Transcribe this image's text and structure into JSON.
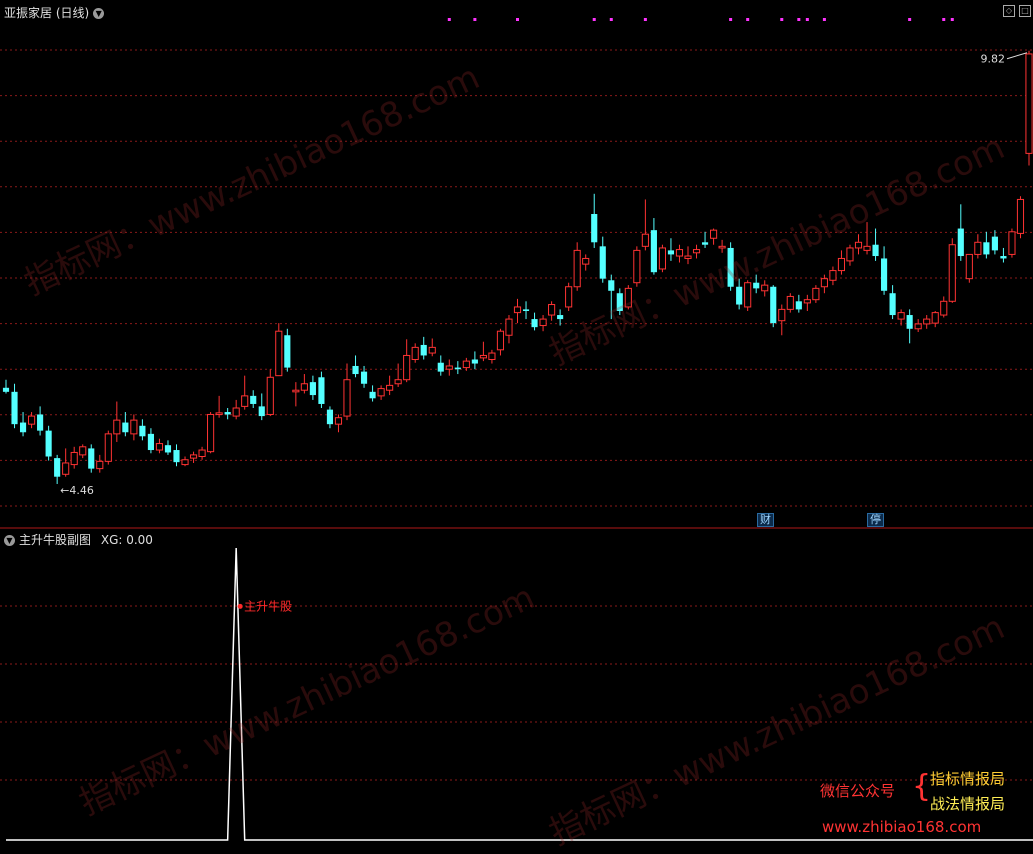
{
  "header": {
    "title": "亚振家居 (日线)",
    "sub_title": "主升牛股副图",
    "sub_indicator": "XG: 0.00"
  },
  "markers": {
    "finance": "财",
    "halt": "停"
  },
  "promo": {
    "wechat_label": "微信公众号",
    "brace": "{",
    "account_1": "指标情报局",
    "account_2": "战法情报局",
    "site": "www.zhibiao168.com"
  },
  "watermark_text": "指标网：www.zhibiao168.com",
  "colors": {
    "up": "#ff3333",
    "down": "#54ffff",
    "grid": "#8a1a1a",
    "signal_dot": "#ff33ff",
    "line": "#ffffff",
    "label": "#ff2a2a"
  },
  "chart_data": [
    {
      "type": "candlestick",
      "title": "亚振家居 (日线)",
      "ylim": [
        4.2,
        10.2
      ],
      "high_label": "9.82",
      "low_label": "4.46",
      "ohlc": [
        [
          5.65,
          5.75,
          5.6,
          5.58
        ],
        [
          5.6,
          5.7,
          5.2,
          5.15
        ],
        [
          5.22,
          5.35,
          5.1,
          5.05
        ],
        [
          5.2,
          5.35,
          5.3,
          5.15
        ],
        [
          5.32,
          5.42,
          5.12,
          5.06
        ],
        [
          5.12,
          5.18,
          4.8,
          4.75
        ],
        [
          4.78,
          4.82,
          4.55,
          4.46
        ],
        [
          4.58,
          4.9,
          4.72,
          4.55
        ],
        [
          4.7,
          4.92,
          4.85,
          4.65
        ],
        [
          4.82,
          4.95,
          4.92,
          4.78
        ],
        [
          4.9,
          4.95,
          4.65,
          4.6
        ],
        [
          4.65,
          4.82,
          4.74,
          4.6
        ],
        [
          4.74,
          5.12,
          5.08,
          4.7
        ],
        [
          5.08,
          5.48,
          5.25,
          4.98
        ],
        [
          5.22,
          5.35,
          5.1,
          5.05
        ],
        [
          5.08,
          5.32,
          5.25,
          5.0
        ],
        [
          5.18,
          5.26,
          5.05,
          5.0
        ],
        [
          5.08,
          5.15,
          4.88,
          4.84
        ],
        [
          4.88,
          5.02,
          4.96,
          4.84
        ],
        [
          4.94,
          5.0,
          4.85,
          4.82
        ],
        [
          4.88,
          4.95,
          4.73,
          4.68
        ],
        [
          4.7,
          4.8,
          4.76,
          4.68
        ],
        [
          4.78,
          4.86,
          4.82,
          4.72
        ],
        [
          4.8,
          4.92,
          4.88,
          4.76
        ],
        [
          4.86,
          5.35,
          5.32,
          4.84
        ],
        [
          5.32,
          5.55,
          5.34,
          5.28
        ],
        [
          5.35,
          5.4,
          5.32,
          5.26
        ],
        [
          5.3,
          5.5,
          5.4,
          5.26
        ],
        [
          5.42,
          5.8,
          5.55,
          5.38
        ],
        [
          5.55,
          5.62,
          5.45,
          5.4
        ],
        [
          5.42,
          5.58,
          5.3,
          5.25
        ],
        [
          5.32,
          5.88,
          5.78,
          5.3
        ],
        [
          5.8,
          6.45,
          6.35,
          5.9
        ],
        [
          6.3,
          6.38,
          5.9,
          5.85
        ],
        [
          5.6,
          5.72,
          5.62,
          5.42
        ],
        [
          5.62,
          5.82,
          5.7,
          5.58
        ],
        [
          5.72,
          5.8,
          5.56,
          5.5
        ],
        [
          5.78,
          5.85,
          5.45,
          5.4
        ],
        [
          5.38,
          5.42,
          5.2,
          5.15
        ],
        [
          5.2,
          5.32,
          5.28,
          5.1
        ],
        [
          5.3,
          5.95,
          5.75,
          5.25
        ],
        [
          5.92,
          6.05,
          5.82,
          5.78
        ],
        [
          5.85,
          5.92,
          5.7,
          5.65
        ],
        [
          5.6,
          5.68,
          5.52,
          5.48
        ],
        [
          5.55,
          5.68,
          5.64,
          5.5
        ],
        [
          5.62,
          5.8,
          5.68,
          5.56
        ],
        [
          5.7,
          5.95,
          5.75,
          5.66
        ],
        [
          5.75,
          6.25,
          6.05,
          5.72
        ],
        [
          6.0,
          6.2,
          6.15,
          5.96
        ],
        [
          6.18,
          6.28,
          6.05,
          6.0
        ],
        [
          6.08,
          6.26,
          6.15,
          6.04
        ],
        [
          5.96,
          6.05,
          5.85,
          5.8
        ],
        [
          5.88,
          6.0,
          5.92,
          5.8
        ],
        [
          5.9,
          5.98,
          5.88,
          5.82
        ],
        [
          5.9,
          6.02,
          5.98,
          5.86
        ],
        [
          6.0,
          6.1,
          5.95,
          5.88
        ],
        [
          6.02,
          6.22,
          6.05,
          5.98
        ],
        [
          6.0,
          6.12,
          6.08,
          5.95
        ],
        [
          6.12,
          6.38,
          6.35,
          6.05
        ],
        [
          6.3,
          6.55,
          6.5,
          6.2
        ],
        [
          6.58,
          6.75,
          6.65,
          6.45
        ],
        [
          6.62,
          6.72,
          6.6,
          6.5
        ],
        [
          6.5,
          6.58,
          6.4,
          6.36
        ],
        [
          6.42,
          6.55,
          6.5,
          6.35
        ],
        [
          6.55,
          6.72,
          6.68,
          6.48
        ],
        [
          6.55,
          6.62,
          6.5,
          6.42
        ],
        [
          6.65,
          6.95,
          6.9,
          6.6
        ],
        [
          6.9,
          7.45,
          7.35,
          6.85
        ],
        [
          7.18,
          7.3,
          7.25,
          7.1
        ],
        [
          7.8,
          8.05,
          7.45,
          7.38
        ],
        [
          7.4,
          7.52,
          7.0,
          6.95
        ],
        [
          6.98,
          7.05,
          6.85,
          6.5
        ],
        [
          6.82,
          6.88,
          6.6,
          6.55
        ],
        [
          6.65,
          6.92,
          6.88,
          6.62
        ],
        [
          6.95,
          7.4,
          7.35,
          6.9
        ],
        [
          7.4,
          7.98,
          7.55,
          7.35
        ],
        [
          7.6,
          7.75,
          7.08,
          7.05
        ],
        [
          7.12,
          7.42,
          7.38,
          7.08
        ],
        [
          7.35,
          7.5,
          7.3,
          7.22
        ],
        [
          7.28,
          7.42,
          7.36,
          7.2
        ],
        [
          7.25,
          7.4,
          7.28,
          7.18
        ],
        [
          7.32,
          7.42,
          7.36,
          7.25
        ],
        [
          7.45,
          7.58,
          7.42,
          7.38
        ],
        [
          7.5,
          7.62,
          7.6,
          7.42
        ],
        [
          7.38,
          7.48,
          7.4,
          7.32
        ],
        [
          7.38,
          7.45,
          6.9,
          6.85
        ],
        [
          6.9,
          7.0,
          6.68,
          6.62
        ],
        [
          6.65,
          6.98,
          6.95,
          6.6
        ],
        [
          6.95,
          7.05,
          6.88,
          6.82
        ],
        [
          6.85,
          6.98,
          6.92,
          6.78
        ],
        [
          6.9,
          6.92,
          6.45,
          6.4
        ],
        [
          6.48,
          6.68,
          6.62,
          6.3
        ],
        [
          6.62,
          6.82,
          6.78,
          6.58
        ],
        [
          6.72,
          6.8,
          6.62,
          6.58
        ],
        [
          6.7,
          6.8,
          6.74,
          6.6
        ],
        [
          6.74,
          6.92,
          6.88,
          6.7
        ],
        [
          6.9,
          7.05,
          7.0,
          6.82
        ],
        [
          6.98,
          7.15,
          7.1,
          6.92
        ],
        [
          7.1,
          7.35,
          7.25,
          7.05
        ],
        [
          7.22,
          7.42,
          7.38,
          7.16
        ],
        [
          7.38,
          7.55,
          7.45,
          7.3
        ],
        [
          7.35,
          7.7,
          7.4,
          7.3
        ],
        [
          7.42,
          7.62,
          7.28,
          7.22
        ],
        [
          7.25,
          7.4,
          6.85,
          6.8
        ],
        [
          6.82,
          6.92,
          6.55,
          6.5
        ],
        [
          6.5,
          6.62,
          6.58,
          6.42
        ],
        [
          6.55,
          6.62,
          6.38,
          6.2
        ],
        [
          6.38,
          6.5,
          6.44,
          6.34
        ],
        [
          6.44,
          6.55,
          6.5,
          6.38
        ],
        [
          6.45,
          6.6,
          6.58,
          6.4
        ],
        [
          6.55,
          6.78,
          6.72,
          6.52
        ],
        [
          6.72,
          7.5,
          7.42,
          6.7
        ],
        [
          7.62,
          7.92,
          7.28,
          7.22
        ],
        [
          7.0,
          7.12,
          7.3,
          6.95
        ],
        [
          7.3,
          7.55,
          7.45,
          7.25
        ],
        [
          7.45,
          7.58,
          7.3,
          7.25
        ],
        [
          7.52,
          7.6,
          7.35,
          7.3
        ],
        [
          7.28,
          7.38,
          7.25,
          7.2
        ],
        [
          7.3,
          7.62,
          7.58,
          7.26
        ],
        [
          7.56,
          8.02,
          7.98,
          7.5
        ],
        [
          8.55,
          9.82,
          9.78,
          8.4
        ]
      ],
      "signal_bars": [
        52,
        55,
        60,
        69,
        71,
        75,
        85,
        87,
        91,
        93,
        94,
        96,
        106,
        110,
        111,
        122,
        124,
        125,
        126,
        131,
        132,
        137,
        138,
        139,
        140,
        141
      ]
    },
    {
      "type": "line",
      "title": "主升牛股副图",
      "ylabel": "XG: 0.00",
      "ylim": [
        0,
        1
      ],
      "x": [
        0,
        26,
        27,
        28,
        141
      ],
      "values": [
        0,
        0,
        1,
        0,
        0
      ],
      "annotation": "主升牛股"
    }
  ]
}
